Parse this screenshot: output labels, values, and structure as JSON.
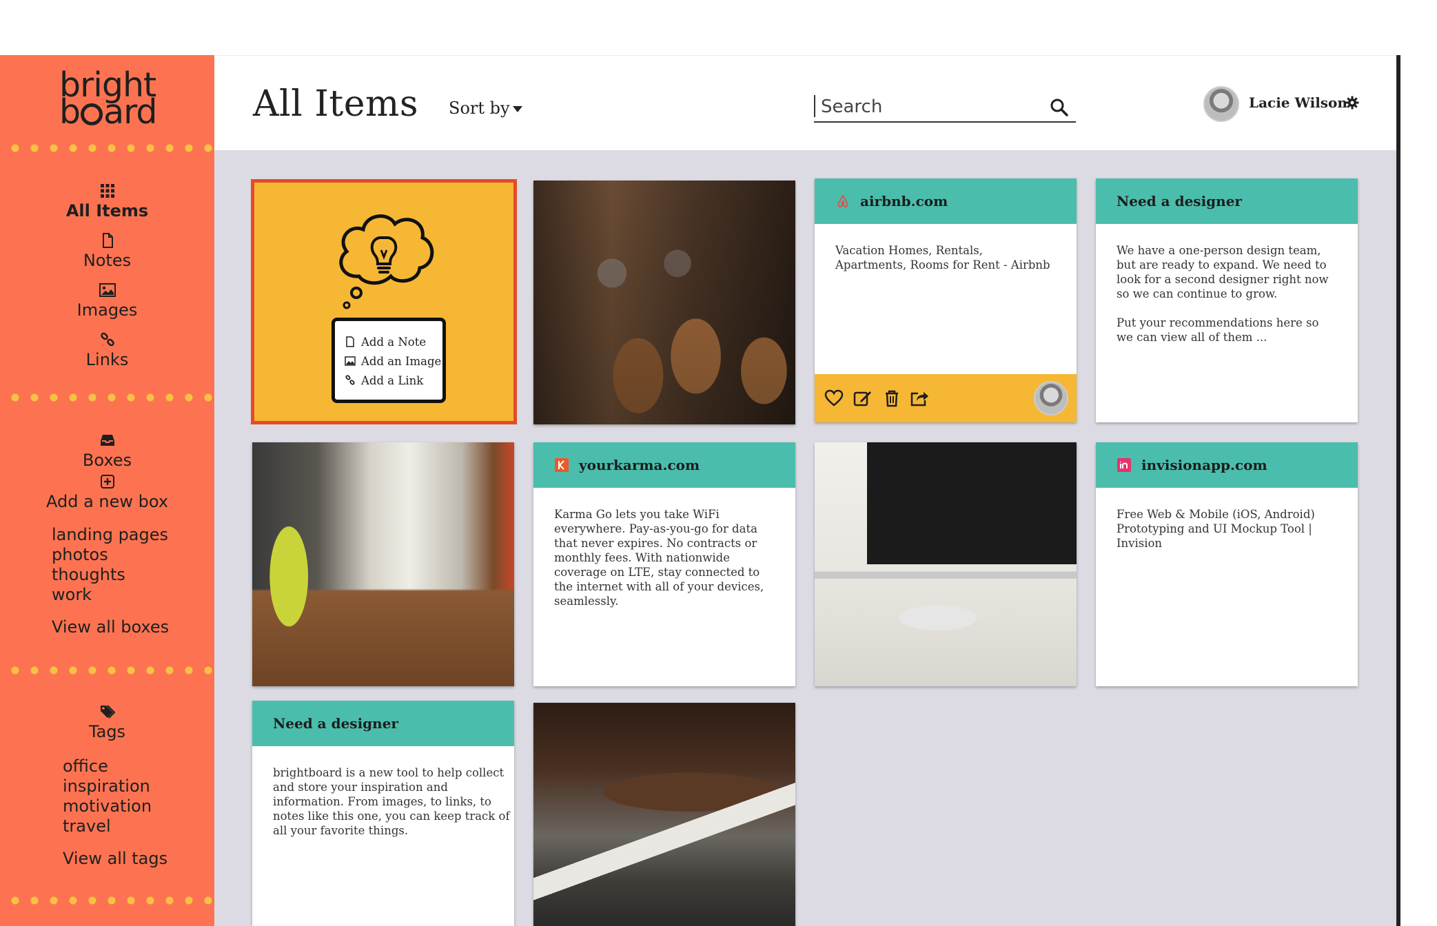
{
  "app": {
    "logo_line1": "bright",
    "logo_line2_pre": "b",
    "logo_line2_post": "ard"
  },
  "sidebar": {
    "nav": [
      {
        "label": "All Items",
        "icon": "grid-icon"
      },
      {
        "label": "Notes",
        "icon": "note-icon"
      },
      {
        "label": "Images",
        "icon": "image-icon"
      },
      {
        "label": "Links",
        "icon": "link-icon"
      }
    ],
    "boxes": {
      "label": "Boxes",
      "add_label": "Add a new box",
      "items": [
        "landing pages",
        "photos",
        "thoughts",
        "work"
      ],
      "view_all": "View all boxes"
    },
    "tags": {
      "label": "Tags",
      "items": [
        "office",
        "inspiration",
        "motivation",
        "travel"
      ],
      "view_all": "View all tags"
    }
  },
  "header": {
    "title": "All Items",
    "sort_label": "Sort by",
    "search_placeholder": "Search",
    "user_name": "Lacie Wilson"
  },
  "add_card": {
    "items": [
      "Add a Note",
      "Add an Image",
      "Add a Link"
    ]
  },
  "cards": {
    "airbnb": {
      "site": "airbnb.com",
      "text": "Vacation Homes, Rentals, Apartments, Rooms for Rent - Airbnb"
    },
    "designer1": {
      "title": "Need a designer",
      "p1": "We have a one-person design team, but are ready to expand. We need to look for a second designer right now so we can continue to grow.",
      "p2": "Put your recommendations here so we can view all of them ..."
    },
    "yourkarma": {
      "site": "yourkarma.com",
      "text": "Karma Go lets you take WiFi everywhere. Pay-as-you-go for data that never expires. No contracts or monthly fees. With nationwide coverage on LTE, stay connected to the internet with all of your devices, seamlessly."
    },
    "invision": {
      "site": "invisionapp.com",
      "text": "Free Web & Mobile (iOS, Android) Prototyping and UI Mockup Tool | Invision"
    },
    "designer2": {
      "title": "Need a designer",
      "text": "brightboard is a new tool to help collect and store your inspiration and information. From images, to links, to notes like this one, you can keep track of all your favorite things."
    }
  },
  "colors": {
    "sidebar": "#fd7351",
    "accent_yellow": "#f6b735",
    "card_header": "#4bbdac",
    "background": "#dcdbe3",
    "highlight_border": "#e34b2a"
  }
}
